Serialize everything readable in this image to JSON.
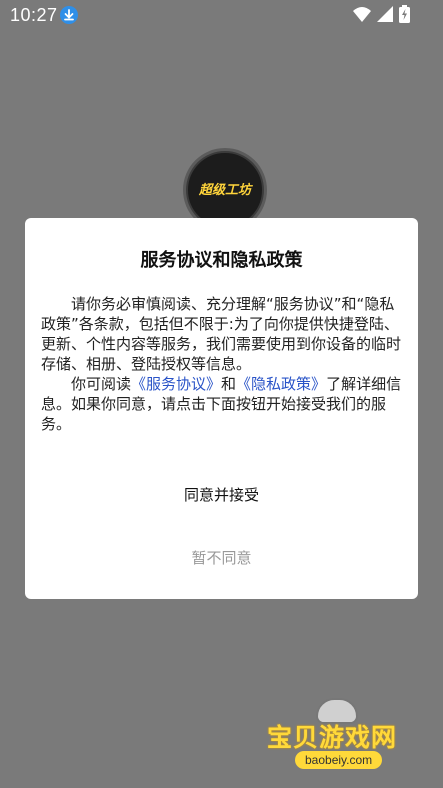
{
  "status_bar": {
    "time": "10:27"
  },
  "splash": {
    "logo_text": "超级工坊"
  },
  "dialog": {
    "title": "服务协议和隐私政策",
    "para1": "请你务必审慎阅读、充分理解“服务协议”和“隐私政策”各条款，包括但不限于:为了向你提供快捷登陆、更新、个性内容等服务，我们需要使用到你设备的临时存储、相册、登陆授权等信息。",
    "para2_before": "你可阅读",
    "link_service": "《服务协议》",
    "para2_and": "和",
    "link_privacy": "《隐私政策》",
    "para2_after": "了解详细信息。如果你同意，请点击下面按钮开始接受我们的服务。",
    "agree_label": "同意并接受",
    "disagree_label": "暂不同意"
  },
  "watermark": {
    "text": "宝贝游戏网",
    "url": "baobeiy.com"
  },
  "colors": {
    "link": "#2a54c8",
    "overlay": "#7a7a7a"
  }
}
